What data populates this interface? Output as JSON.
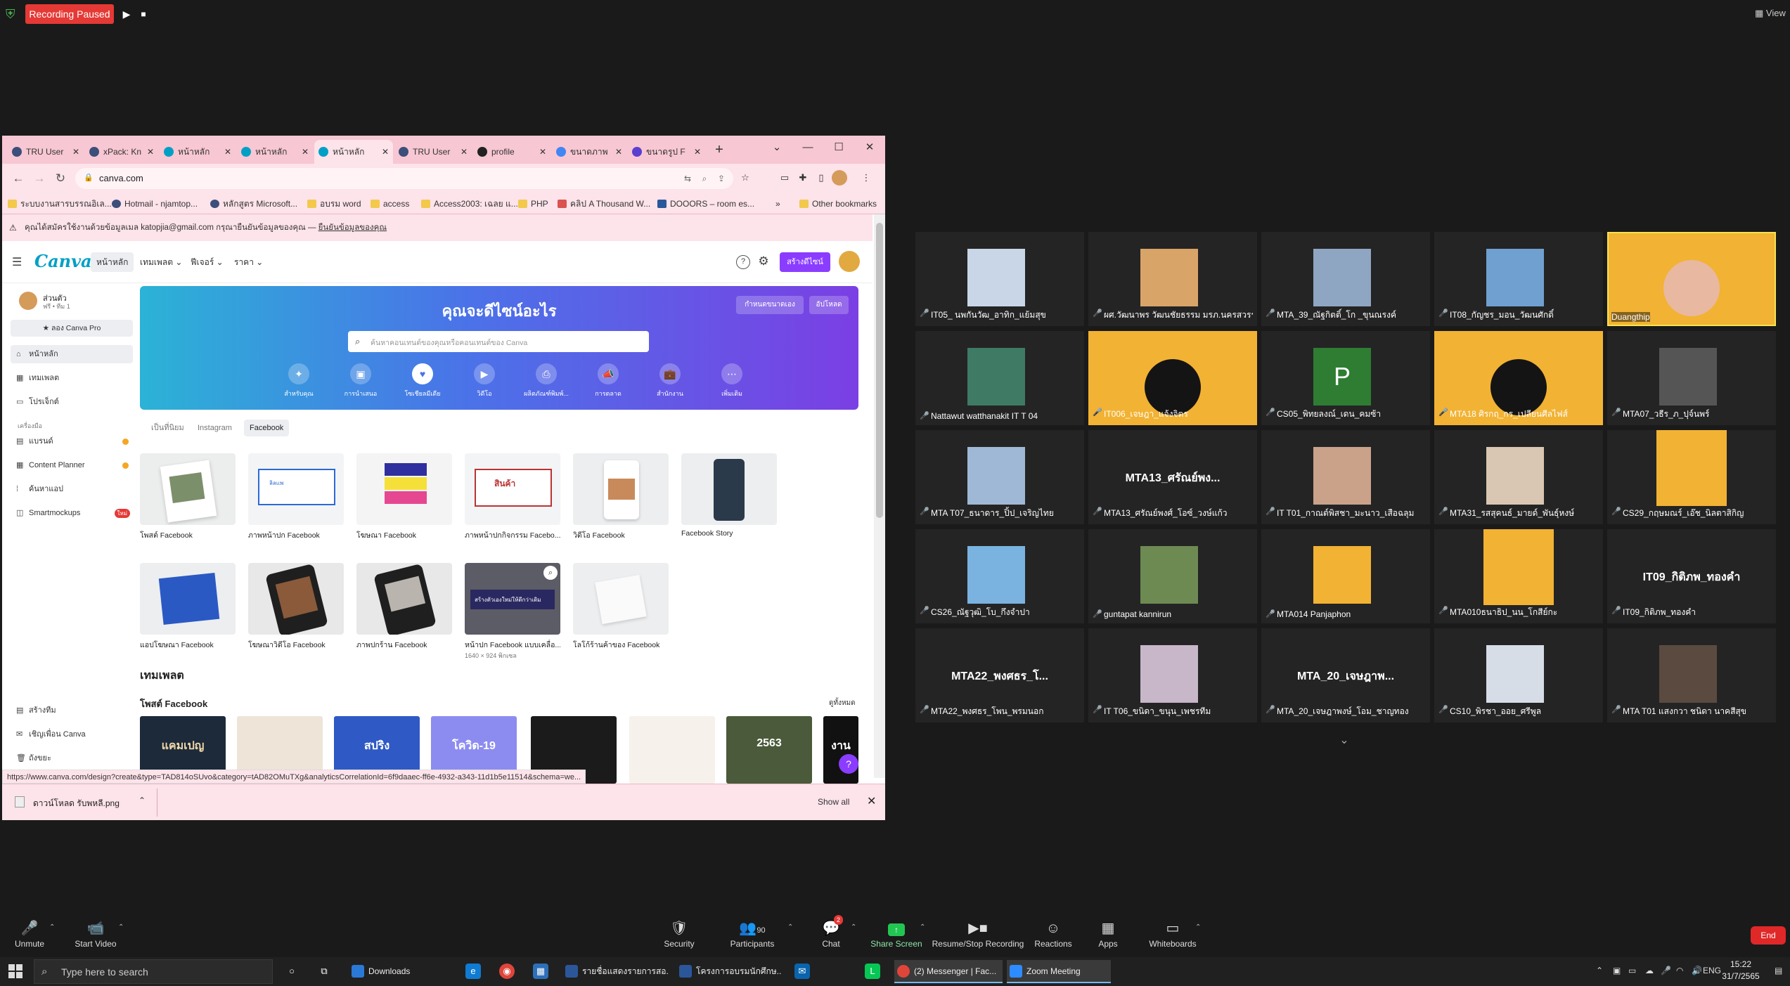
{
  "recording": {
    "status": "Recording Paused",
    "play": "▶",
    "stop": "■",
    "view": "View"
  },
  "browser": {
    "tabs": [
      {
        "label": "TRU User"
      },
      {
        "label": "xPack: Kn"
      },
      {
        "label": "หน้าหลัก"
      },
      {
        "label": "หน้าหลัก"
      },
      {
        "label": "หน้าหลัก"
      },
      {
        "label": "TRU User"
      },
      {
        "label": "profile"
      },
      {
        "label": "ขนาดภาพ"
      },
      {
        "label": "ขนาดรูป F"
      }
    ],
    "new_tab": "+",
    "url": "canva.com",
    "bookmarks": [
      "ระบบงานสารบรรณอิเล...",
      "Hotmail - njamtop...",
      "หลักสูตร Microsoft...",
      "อบรม word",
      "access",
      "Access2003: เฉลย แ...",
      "PHP",
      "คลิป A Thousand W...",
      "DOOORS – room es...",
      "Other bookmarks"
    ]
  },
  "canva": {
    "notice": "คุณได้สมัครใช้งานด้วยข้อมูลเมล katopjia@gmail.com กรุณายืนยันข้อมูลของคุณ",
    "notice_link": "ยืนยันข้อมูลของคุณ",
    "logo": "Canva",
    "nav": [
      "หน้าหลัก",
      "เทมเพลต ⌄",
      "ฟีเจอร์ ⌄",
      "ราคา ⌄"
    ],
    "create_btn": "สร้างดีไซน์",
    "user_name": "ส่วนตัว",
    "user_sub": "ฟรี • ทีม 1",
    "pro_btn": "★ ลอง Canva Pro",
    "sidebar": [
      {
        "label": "หน้าหลัก",
        "icon": "⌂"
      },
      {
        "label": "เทมเพลต",
        "icon": "▦"
      },
      {
        "label": "โปรเจ็กต์",
        "icon": "▭"
      }
    ],
    "apps_section": "เครื่องมือ",
    "apps": [
      {
        "label": "แบรนด์",
        "icon": "▤"
      },
      {
        "label": "Content Planner",
        "icon": "▦"
      },
      {
        "label": "ค้นหาแอป",
        "icon": "⁞"
      },
      {
        "label": "Smartmockups",
        "icon": "◫",
        "badge": "ใหม่"
      }
    ],
    "sidebar_bottom": [
      {
        "label": "สร้างทีม",
        "icon": "▤"
      },
      {
        "label": "เชิญเพื่อน Canva",
        "icon": "✉"
      },
      {
        "label": "ถังขยะ",
        "icon": "🗑"
      }
    ],
    "hero": {
      "title": "คุณจะดีไซน์อะไร",
      "custom_size": "กำหนดขนาดเอง",
      "upload": "อัปโหลด",
      "search_placeholder": "ค้นหาคอนเทนต์ของคุณหรือคอนเทนต์ของ Canva",
      "categories": [
        {
          "label": "สำหรับคุณ",
          "icon": "✦"
        },
        {
          "label": "การนำเสนอ",
          "icon": "▣"
        },
        {
          "label": "โซเชียลมีเดีย",
          "icon": "♥"
        },
        {
          "label": "วิดีโอ",
          "icon": "▶"
        },
        {
          "label": "ผลิตภัณฑ์พิมพ์...",
          "icon": "⎙"
        },
        {
          "label": "การตลาด",
          "icon": "📣"
        },
        {
          "label": "สำนักงาน",
          "icon": "💼"
        },
        {
          "label": "เพิ่มเติม",
          "icon": "⋯"
        }
      ]
    },
    "template_tabs": [
      "เป็นที่นิยม",
      "Instagram",
      "Facebook"
    ],
    "tiles_row1": [
      {
        "label": "โพสต์ Facebook"
      },
      {
        "label": "ภาพหน้าปก Facebook"
      },
      {
        "label": "โฆษณา Facebook"
      },
      {
        "label": "ภาพหน้าปกกิจกรรม Facebo..."
      },
      {
        "label": "วิดีโอ Facebook"
      },
      {
        "label": "Facebook Story"
      }
    ],
    "tiles_row2": [
      {
        "label": "แอปโฆษณา Facebook"
      },
      {
        "label": "โฆษณาวิดีโอ Facebook"
      },
      {
        "label": "ภาพปกร้าน Facebook"
      },
      {
        "label": "หน้าปก Facebook แบบเคลื่อ...",
        "sub": "1640 × 924 พิกเซล"
      },
      {
        "label": "โลโก้ร้านค้าของ Facebook"
      }
    ],
    "thumb_text": {
      "cover": "ลิลแพ",
      "event": "สินค้า",
      "dark_event": "สร้างตัวเองใหม่ให้ดีกว่าเดิม"
    },
    "templates_heading": "เทมเพลต",
    "fb_post_heading": "โพสต์ Facebook",
    "see_all": "ดูทั้งหมด",
    "fb_templates": [
      {
        "text": "แคมเปญ",
        "bg": "#1c2a3a",
        "fg": "#f0d9a8"
      },
      {
        "text": "",
        "bg": "#eee4d8",
        "fg": "#555"
      },
      {
        "text": "สปริง",
        "bg": "#2f59c4",
        "fg": "#ffffff"
      },
      {
        "text": "โควิด-19",
        "bg": "#8c8cf0",
        "fg": "#ffffff"
      },
      {
        "text": "",
        "bg": "#1b1b1b",
        "fg": "#d4af37"
      },
      {
        "text": "",
        "bg": "#f6f1ea",
        "fg": "#b33"
      },
      {
        "text": "2563",
        "bg": "#4a5a3a",
        "fg": "#ffffff"
      },
      {
        "text": "งาน",
        "bg": "#111111",
        "fg": "#ffffff"
      }
    ],
    "help": "?"
  },
  "status_url": "https://www.canva.com/design?create&type=TAD814oSUvo&category=tAD82OMuTXg&analyticsCorrelationId=6f9daaec-ff6e-4932-a343-11d1b5e11514&schema=we...",
  "download": {
    "file": "ดาวน์โหลด รับพหลี.png",
    "chevron": "⌃",
    "show_all": "Show all",
    "close": "✕"
  },
  "zoom": {
    "participants": [
      {
        "name": "IT05_ นพกันวัฒ_อาทิก_แย้มสุข",
        "type": "photo",
        "color": "#c9d6e8"
      },
      {
        "name": "ผศ.วัฒนาพร วัฒนชัยธรรม มรภ.นครสวรรค์",
        "type": "photo",
        "color": "#d9a468"
      },
      {
        "name": "MTA_39_ณัฐกิตติ์_โก _ขุนณรงค์",
        "type": "photo",
        "color": "#8fa6c2"
      },
      {
        "name": "IT08_กัญชร_มอน_วัฒนศักดิ์",
        "type": "photo",
        "color": "#6fa0d0"
      },
      {
        "name": "Duangthip",
        "type": "active",
        "color": "#f2b233"
      },
      {
        "name": "Nattawut watthanakit IT T 04",
        "type": "photo",
        "color": "#3e7a64"
      },
      {
        "name": "IT006_เจษฎา_แจ้งจิตร",
        "type": "banner",
        "color": "#f2b233"
      },
      {
        "name": "CS05_พิทยลงณ์_เดน_คมซ้า",
        "type": "letter",
        "letter": "P",
        "color": "#2e7d32"
      },
      {
        "name": "MTA18 ศิรกฤ_กร_เปลียนศีลไฟส์",
        "type": "banner",
        "color": "#f2b233"
      },
      {
        "name": "MTA07_วธีร_ภ_ปุจ์นพร์",
        "type": "photo",
        "color": "#555"
      },
      {
        "name": "MTA T07_ธนาดาร_ปิ้ป_เจริญไทย",
        "type": "photo",
        "color": "#9fb8d6"
      },
      {
        "name": "MTA13_ศรัณย์พงศ์_โอซ์_วงษ์แก้ว",
        "type": "text",
        "big": "MTA13_ศรัณย์พง..."
      },
      {
        "name": "IT T01_กาณต์พิสชา_มะนาว_เสือฉลุม",
        "type": "photo",
        "color": "#caa28a"
      },
      {
        "name": "MTA31_รสสุคนธ์_มายด์_พันธุ์หงษ์",
        "type": "photo",
        "color": "#d9c7b3"
      },
      {
        "name": "CS29_กฤษมณร์_เอ๊ช_นิลตาสิกิญ",
        "type": "banner-tall",
        "color": "#f2b233"
      },
      {
        "name": "CS26_ณัฐวุฒิ_โบ_กึงจำปา",
        "type": "photo",
        "color": "#7ab3e0"
      },
      {
        "name": "guntapat kannirun",
        "type": "photo",
        "color": "#6d8a52"
      },
      {
        "name": "MTA014 Panjaphon",
        "type": "banner-sm",
        "color": "#f2b233"
      },
      {
        "name": "MTA010ธนาธิป_นน_โกสีย์กะ",
        "type": "banner-tall",
        "color": "#f2b233"
      },
      {
        "name": "IT09_กิติภพ_ทองคำ",
        "type": "text",
        "big": "IT09_กิติภพ_ทองคำ"
      },
      {
        "name": "MTA22_พงศธร_โพน_พรมนอก",
        "type": "text",
        "big": "MTA22_พงศธร_โ..."
      },
      {
        "name": "IT T06_ขนิดา_ขนุน_เพชรทีม",
        "type": "photo",
        "color": "#c7b7c9"
      },
      {
        "name": "MTA_20_เจษฎาพงษ์_โอม_ชาญทอง",
        "type": "text",
        "big": "MTA_20_เจษฎาพ..."
      },
      {
        "name": "CS10_พิรชา_ออย_ศรีพูล",
        "type": "photo",
        "color": "#d7dde6"
      },
      {
        "name": "MTA T01 แสงกวา ชนิดา นาคสีสุข",
        "type": "photo",
        "color": "#5b4a40"
      }
    ],
    "next": "⌄",
    "controls": [
      {
        "label": "Unmute",
        "icon": "🎤"
      },
      {
        "label": "Start Video",
        "icon": "📹"
      },
      {
        "label": "Security",
        "icon": "🛡"
      },
      {
        "label": "Participants",
        "icon": "👥",
        "count": "90"
      },
      {
        "label": "Chat",
        "icon": "💬",
        "count": "2"
      },
      {
        "label": "Share Screen",
        "icon": "↑"
      },
      {
        "label": "Resume/Stop Recording",
        "icon": "▶■"
      },
      {
        "label": "Reactions",
        "icon": "☺"
      },
      {
        "label": "Apps",
        "icon": "▦"
      },
      {
        "label": "Whiteboards",
        "icon": "▭"
      }
    ],
    "end": "End"
  },
  "taskbar": {
    "search_placeholder": "Type here to search",
    "apps": [
      {
        "label": "Downloads",
        "color": "#f2c94c"
      },
      {
        "label": "รายชื่อแสดงรายการสอ...",
        "color": "#2b579a"
      },
      {
        "label": "โครงการอบรมนักศึกษ...",
        "color": "#2b579a"
      },
      {
        "label": "(2) Messenger | Fac...",
        "color": "#4285f4"
      },
      {
        "label": "Zoom Meeting",
        "color": "#2d8cff"
      }
    ],
    "lang": "ENG",
    "time": "15:22",
    "date": "31/7/2565"
  },
  "colors": {
    "canva_purple": "#8b3dff",
    "recording_red": "#e53935",
    "zoom_share_green": "#23c552",
    "active_speaker": "#f7e34f"
  }
}
